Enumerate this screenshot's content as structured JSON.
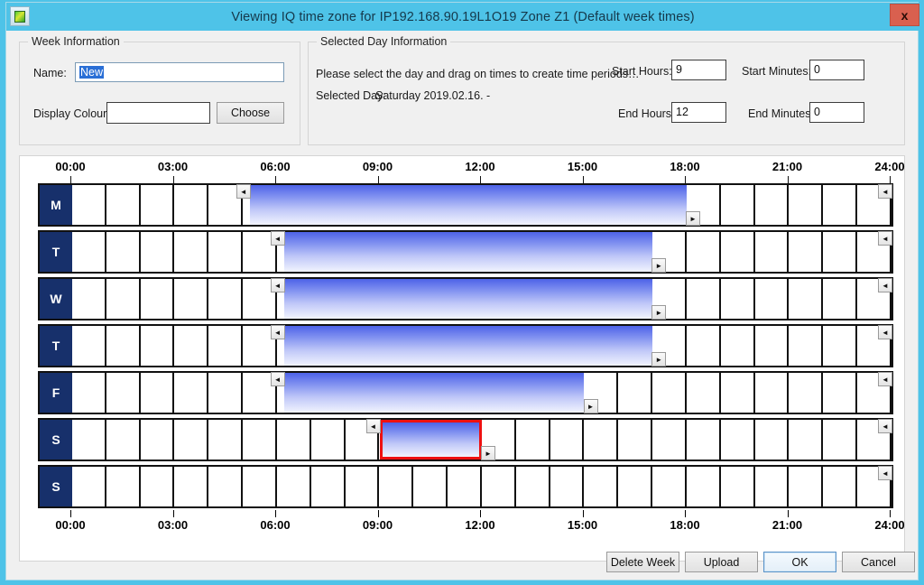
{
  "window": {
    "title": "Viewing IQ time zone for  IP192.168.90.19L1O19 Zone Z1 (Default week times)",
    "app_icon": "schedule-icon",
    "close_label": "x",
    "accent": "#4ec3e8",
    "navy": "#17306b",
    "selection_red": "#ee1111",
    "bar_top_color": "#4d62e8"
  },
  "week_information": {
    "group_title": "Week Information",
    "name_label": "Name:",
    "name_value": "New",
    "name_placeholder": "",
    "colour_label": "Display Colour:",
    "colour_value": "",
    "choose_label": "Choose"
  },
  "selected_day_information": {
    "group_title": "Selected Day Information",
    "instruction": "Please select the day and drag on times to create time periods…",
    "selected_day_label": "Selected Day:",
    "selected_day_value": "Saturday 2019.02.16. -",
    "start_hours_label": "Start Hours:",
    "start_hours_value": "9",
    "start_minutes_label": "Start Minutes:",
    "start_minutes_value": "0",
    "end_hours_label": "End Hours:",
    "end_hours_value": "12",
    "end_minutes_label": "End Minutes:",
    "end_minutes_value": "0"
  },
  "schedule": {
    "axis_labels": [
      "00:00",
      "03:00",
      "06:00",
      "09:00",
      "12:00",
      "15:00",
      "18:00",
      "21:00",
      "24:00"
    ],
    "axis_hours": [
      0,
      3,
      6,
      9,
      12,
      15,
      18,
      21,
      24
    ],
    "hours_total": 24,
    "handle_left_glyph": "◄",
    "handle_right_glyph": "►",
    "rows": [
      {
        "day": "M",
        "day_name": "Monday",
        "periods": [
          {
            "start": 5.2,
            "end": 18.0,
            "selected": false
          }
        ],
        "end_handle_hour": 24.0
      },
      {
        "day": "T",
        "day_name": "Tuesday",
        "periods": [
          {
            "start": 6.2,
            "end": 17.0,
            "selected": false
          }
        ],
        "end_handle_hour": 24.0
      },
      {
        "day": "W",
        "day_name": "Wednesday",
        "periods": [
          {
            "start": 6.2,
            "end": 17.0,
            "selected": false
          }
        ],
        "end_handle_hour": 24.0
      },
      {
        "day": "T",
        "day_name": "Thursday",
        "periods": [
          {
            "start": 6.2,
            "end": 17.0,
            "selected": false
          }
        ],
        "end_handle_hour": 24.0
      },
      {
        "day": "F",
        "day_name": "Friday",
        "periods": [
          {
            "start": 6.2,
            "end": 15.0,
            "selected": false
          }
        ],
        "end_handle_hour": 24.0
      },
      {
        "day": "S",
        "day_name": "Saturday",
        "periods": [
          {
            "start": 9.0,
            "end": 12.0,
            "selected": true
          }
        ],
        "end_handle_hour": 24.0
      },
      {
        "day": "S",
        "day_name": "Sunday",
        "periods": [],
        "end_handle_hour": 24.0
      }
    ]
  },
  "footer": {
    "delete_week_label": "Delete Week",
    "upload_label": "Upload",
    "ok_label": "OK",
    "cancel_label": "Cancel"
  }
}
